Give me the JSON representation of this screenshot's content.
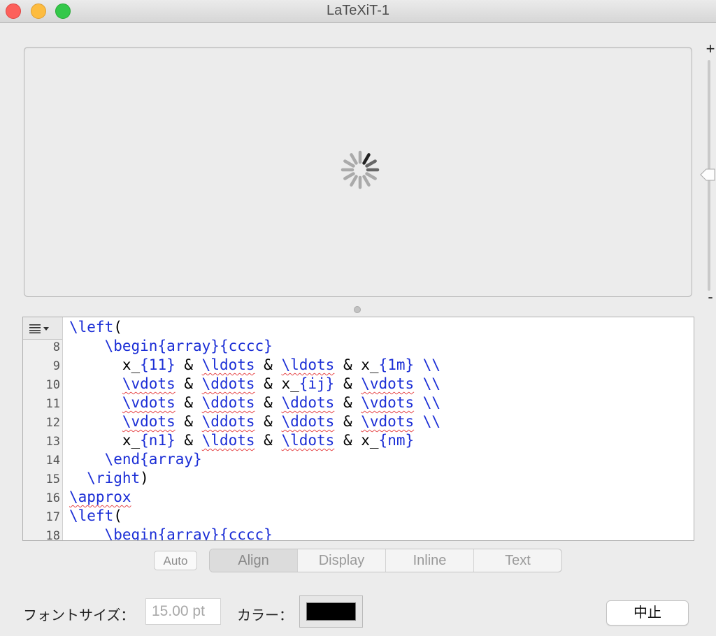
{
  "window": {
    "title": "LaTeXiT-1"
  },
  "zoom": {
    "plus_label": "+",
    "minus_label": "-",
    "level": 0.5
  },
  "editor": {
    "line_numbers": [
      "8",
      "9",
      "10",
      "11",
      "12",
      "13",
      "14",
      "15",
      "16",
      "17",
      "18"
    ],
    "lines": [
      [
        {
          "t": "\\left",
          "c": "kw"
        },
        {
          "t": "(",
          "c": ""
        }
      ],
      [
        {
          "t": "    ",
          "c": ""
        },
        {
          "t": "\\begin",
          "c": "kw"
        },
        {
          "t": "{array}{cccc}",
          "c": "kw"
        }
      ],
      [
        {
          "t": "      x_",
          "c": ""
        },
        {
          "t": "{11}",
          "c": "kw"
        },
        {
          "t": " & ",
          "c": ""
        },
        {
          "t": "\\ldots",
          "c": "kw sq"
        },
        {
          "t": " & ",
          "c": ""
        },
        {
          "t": "\\ldots",
          "c": "kw sq"
        },
        {
          "t": " & x_",
          "c": ""
        },
        {
          "t": "{1m}",
          "c": "kw"
        },
        {
          "t": " \\\\",
          "c": "kw"
        }
      ],
      [
        {
          "t": "      ",
          "c": ""
        },
        {
          "t": "\\vdots",
          "c": "kw sq"
        },
        {
          "t": " & ",
          "c": ""
        },
        {
          "t": "\\ddots",
          "c": "kw sq"
        },
        {
          "t": " & x_",
          "c": ""
        },
        {
          "t": "{ij}",
          "c": "kw"
        },
        {
          "t": " & ",
          "c": ""
        },
        {
          "t": "\\vdots",
          "c": "kw sq"
        },
        {
          "t": " \\\\",
          "c": "kw"
        }
      ],
      [
        {
          "t": "      ",
          "c": ""
        },
        {
          "t": "\\vdots",
          "c": "kw sq"
        },
        {
          "t": " & ",
          "c": ""
        },
        {
          "t": "\\ddots",
          "c": "kw sq"
        },
        {
          "t": " & ",
          "c": ""
        },
        {
          "t": "\\ddots",
          "c": "kw sq"
        },
        {
          "t": " & ",
          "c": ""
        },
        {
          "t": "\\vdots",
          "c": "kw sq"
        },
        {
          "t": " \\\\",
          "c": "kw"
        }
      ],
      [
        {
          "t": "      ",
          "c": ""
        },
        {
          "t": "\\vdots",
          "c": "kw sq"
        },
        {
          "t": " & ",
          "c": ""
        },
        {
          "t": "\\ddots",
          "c": "kw sq"
        },
        {
          "t": " & ",
          "c": ""
        },
        {
          "t": "\\ddots",
          "c": "kw sq"
        },
        {
          "t": " & ",
          "c": ""
        },
        {
          "t": "\\vdots",
          "c": "kw sq"
        },
        {
          "t": " \\\\",
          "c": "kw"
        }
      ],
      [
        {
          "t": "      x_",
          "c": ""
        },
        {
          "t": "{n1}",
          "c": "kw"
        },
        {
          "t": " & ",
          "c": ""
        },
        {
          "t": "\\ldots",
          "c": "kw sq"
        },
        {
          "t": " & ",
          "c": ""
        },
        {
          "t": "\\ldots",
          "c": "kw sq"
        },
        {
          "t": " & x_",
          "c": ""
        },
        {
          "t": "{nm}",
          "c": "kw"
        }
      ],
      [
        {
          "t": "    ",
          "c": ""
        },
        {
          "t": "\\end",
          "c": "kw"
        },
        {
          "t": "{array}",
          "c": "kw"
        }
      ],
      [
        {
          "t": "  ",
          "c": ""
        },
        {
          "t": "\\right",
          "c": "kw"
        },
        {
          "t": ")",
          "c": ""
        }
      ],
      [
        {
          "t": "\\approx",
          "c": "kw sq"
        }
      ],
      [
        {
          "t": "\\left",
          "c": "kw"
        },
        {
          "t": "(",
          "c": ""
        }
      ],
      [
        {
          "t": "    ",
          "c": ""
        },
        {
          "t": "\\begin",
          "c": "kw"
        },
        {
          "t": "{array}{cccc}",
          "c": "kw"
        }
      ]
    ]
  },
  "mode": {
    "auto_label": "Auto",
    "options": [
      "Align",
      "Display",
      "Inline",
      "Text"
    ],
    "selected": "Align"
  },
  "bottom": {
    "font_size_label": "フォントサイズ：",
    "font_size_value": "15.00 pt",
    "color_label": "カラー：",
    "color_value": "#000000",
    "stop_label": "中止"
  },
  "colors": {
    "keyword": "#1b2ed6",
    "spellcheck": "#e6494b"
  }
}
